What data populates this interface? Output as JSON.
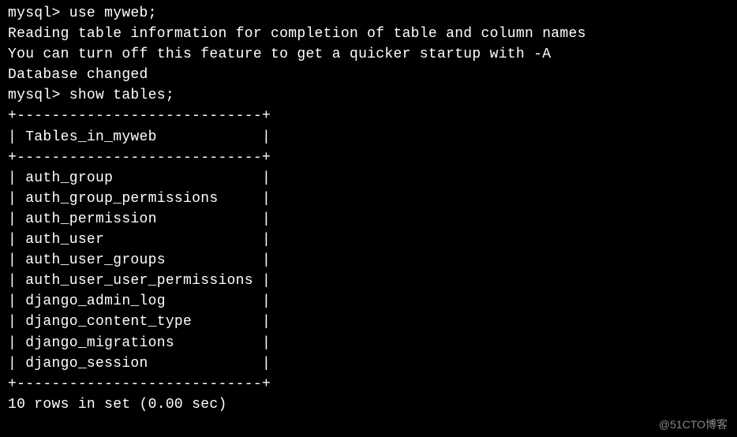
{
  "terminal": {
    "prompt": "mysql> ",
    "cmd_use": "use myweb;",
    "msg_reading": "Reading table information for completion of table and column names",
    "msg_turnoff": "You can turn off this feature to get a quicker startup with -A",
    "blank": "",
    "msg_dbchanged": "Database changed",
    "cmd_show": "show tables;",
    "border_line": "+----------------------------+",
    "header_row": "| Tables_in_myweb            |",
    "rows": [
      "| auth_group                 |",
      "| auth_group_permissions     |",
      "| auth_permission            |",
      "| auth_user                  |",
      "| auth_user_groups           |",
      "| auth_user_user_permissions |",
      "| django_admin_log           |",
      "| django_content_type        |",
      "| django_migrations          |",
      "| django_session             |"
    ],
    "summary": "10 rows in set (0.00 sec)"
  },
  "watermark": "@51CTO博客"
}
